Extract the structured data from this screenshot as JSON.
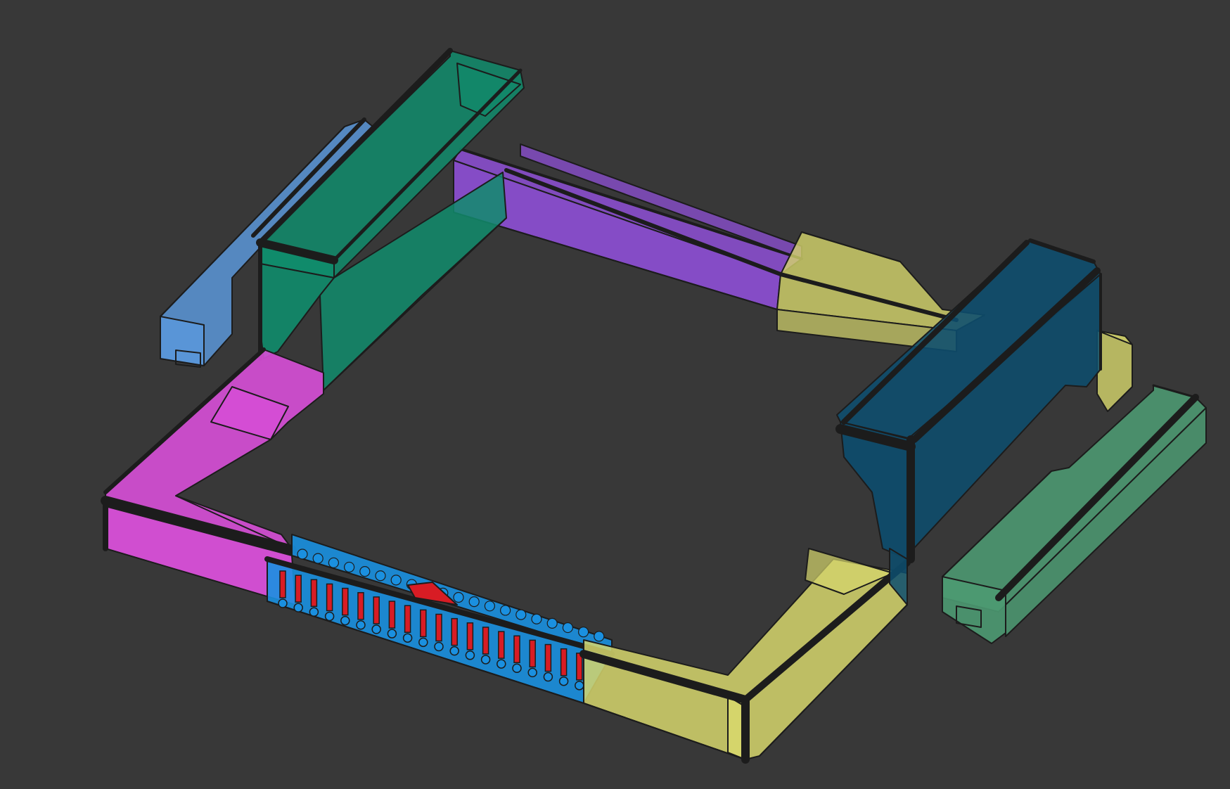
{
  "viewport": {
    "background_color": "#383838"
  },
  "colors": {
    "outline": "#1c1c1c",
    "purple": "#8e4fd6",
    "magenta": "#d84fd8",
    "green": "#108c6c",
    "light_blue": "#5a96d8",
    "yellow": "#d6d66c",
    "dark_blue": "#0c4d6e",
    "sage_green": "#4c9a72",
    "cyan": "#1a90e0",
    "red": "#d81c24"
  },
  "parts": [
    {
      "name": "purple-segment",
      "color": "purple"
    },
    {
      "name": "magenta-corner",
      "color": "magenta"
    },
    {
      "name": "green-riser",
      "color": "green"
    },
    {
      "name": "light-blue-rail",
      "color": "light_blue"
    },
    {
      "name": "yellow-segment",
      "color": "yellow"
    },
    {
      "name": "dark-blue-riser",
      "color": "dark_blue"
    },
    {
      "name": "sage-green-rail",
      "color": "sage_green"
    },
    {
      "name": "cyan-rack-segment",
      "color": "cyan"
    },
    {
      "name": "red-rack-teeth",
      "color": "red"
    }
  ]
}
